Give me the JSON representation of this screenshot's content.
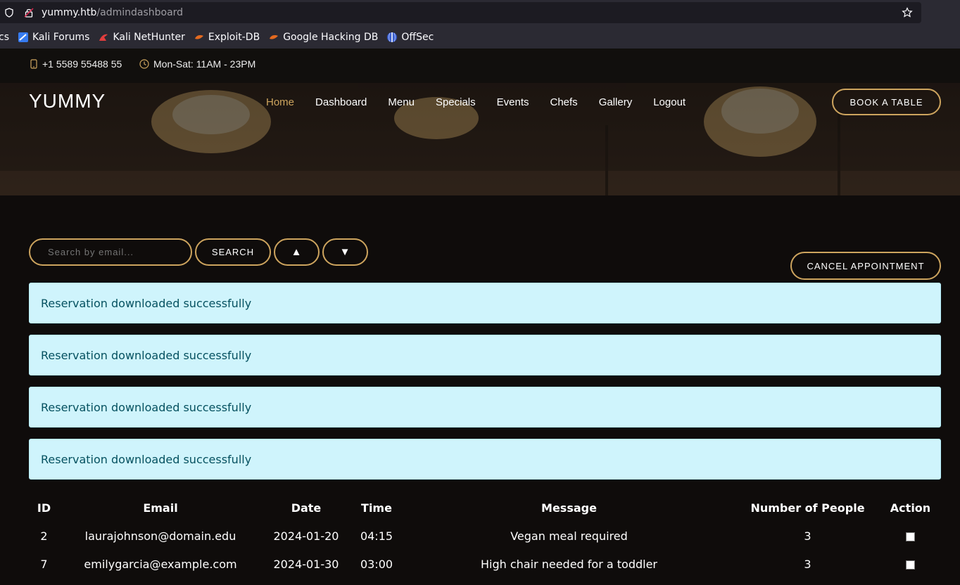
{
  "browser": {
    "url_host": "yummy.htb",
    "url_path": "/admindashboard",
    "bookmarks": [
      {
        "label": "cs",
        "icon": "none"
      },
      {
        "label": "Kali Forums",
        "icon": "kali-forums-icon"
      },
      {
        "label": "Kali NetHunter",
        "icon": "kali-nethunter-icon"
      },
      {
        "label": "Exploit-DB",
        "icon": "exploit-db-icon"
      },
      {
        "label": "Google Hacking DB",
        "icon": "ghdb-icon"
      },
      {
        "label": "OffSec",
        "icon": "offsec-icon"
      }
    ]
  },
  "topbar": {
    "phone": "+1 5589 55488 55",
    "hours": "Mon-Sat: 11AM - 23PM"
  },
  "header": {
    "brand": "YUMMY",
    "nav": [
      "Home",
      "Dashboard",
      "Menu",
      "Specials",
      "Events",
      "Chefs",
      "Gallery",
      "Logout"
    ],
    "active_nav": "Home",
    "book_label": "BOOK A TABLE"
  },
  "controls": {
    "search_placeholder": "Search by email...",
    "search_label": "SEARCH",
    "sort_up_label": "▲",
    "sort_down_label": "▼",
    "cancel_label": "CANCEL APPOINTMENT"
  },
  "alerts": [
    "Reservation downloaded successfully",
    "Reservation downloaded successfully",
    "Reservation downloaded successfully",
    "Reservation downloaded successfully"
  ],
  "table": {
    "headers": [
      "ID",
      "Email",
      "Date",
      "Time",
      "Message",
      "Number of People",
      "Action"
    ],
    "rows": [
      {
        "id": "2",
        "email": "laurajohnson@domain.edu",
        "date": "2024-01-20",
        "time": "04:15",
        "message": "Vegan meal required",
        "people": "3"
      },
      {
        "id": "7",
        "email": "emilygarcia@example.com",
        "date": "2024-01-30",
        "time": "03:00",
        "message": "High chair needed for a toddler",
        "people": "3"
      }
    ]
  },
  "colors": {
    "accent": "#cda45e",
    "alert_bg": "#cff4fc",
    "alert_text": "#055160"
  }
}
